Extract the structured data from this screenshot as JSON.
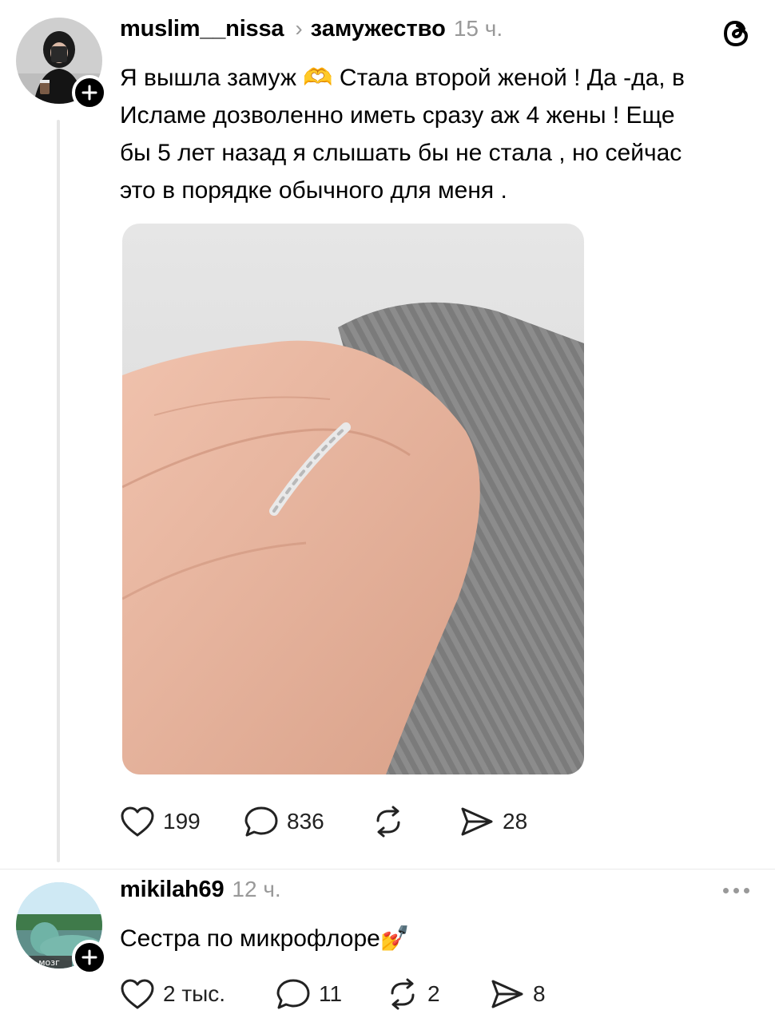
{
  "post": {
    "username": "muslim__nissa",
    "topic": "замужество",
    "time": "15 ч.",
    "text_lines": [
      "Я вышла замуж 🫶 Стала второй женой ! Да -да, в",
      "Исламе дозволенно иметь сразу аж 4 жены ! Еще",
      "бы 5 лет назад я слышать бы не стала , но сейчас",
      "это в порядке обычного для меня ."
    ],
    "likes": "199",
    "comments": "836",
    "shares": "28"
  },
  "reply": {
    "username": "mikilah69",
    "time": "12 ч.",
    "text": "Сестра по микрофлоре💅",
    "avatar_caption": "о мозг",
    "likes": "2 тыс.",
    "comments": "11",
    "reposts": "2",
    "shares": "8"
  },
  "icons": {
    "avatar_plus": "plus-icon",
    "logo": "threads-logo",
    "like": "heart-icon",
    "comment": "speech-bubble-icon",
    "repost": "repost-icon",
    "share": "send-icon",
    "more": "ellipsis-icon"
  },
  "colors": {
    "text": "#000000",
    "muted": "#999999",
    "thread_line": "#e6e6e6",
    "sweater": "#8a8a8a",
    "skin": "#e6b29c"
  }
}
